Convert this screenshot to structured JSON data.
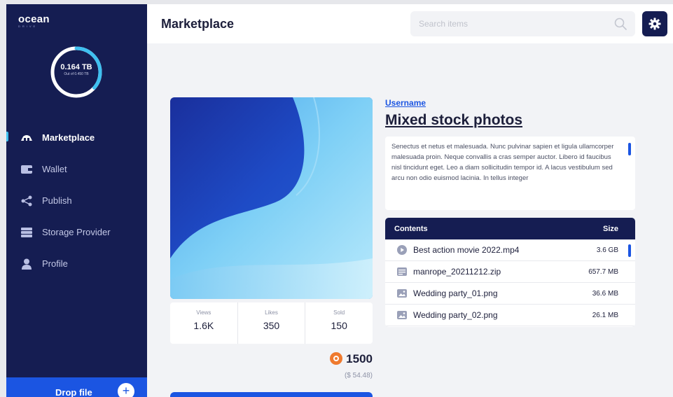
{
  "brand": {
    "name": "ocean",
    "tagline": "DRIVE"
  },
  "storage": {
    "used": "0.164 TB",
    "total_label": "Out of 0.450 TB",
    "fraction_used": 0.364
  },
  "nav": [
    {
      "label": "Marketplace",
      "icon": "marketplace-icon",
      "active": true
    },
    {
      "label": "Wallet",
      "icon": "wallet-icon",
      "active": false
    },
    {
      "label": "Publish",
      "icon": "share-icon",
      "active": false
    },
    {
      "label": "Storage Provider",
      "icon": "storage-icon",
      "active": false
    },
    {
      "label": "Profile",
      "icon": "user-icon",
      "active": false
    }
  ],
  "drop": {
    "label": "Drop file"
  },
  "header": {
    "title": "Marketplace",
    "search_placeholder": "Search items"
  },
  "item": {
    "username": "Username",
    "title": "Mixed stock photos",
    "description": "Senectus et netus et malesuada.  Nunc pulvinar sapien et ligula ullamcorper malesuada proin. Neque  convallis a cras semper auctor. Libero id faucibus nisl tincidunt eget. Leo a diam sollicitudin tempor id. A  lacus vestibulum sed arcu non odio  euismod lacinia. In tellus integer",
    "stats": [
      {
        "label": "Views",
        "value": "1.6K"
      },
      {
        "label": "Likes",
        "value": "350"
      },
      {
        "label": "Sold",
        "value": "150"
      }
    ],
    "price": "1500",
    "price_usd": "($ 54.48)"
  },
  "contents": {
    "header_name": "Contents",
    "header_size": "Size",
    "files": [
      {
        "name": "Best action movie 2022.mp4",
        "size": "3.6 GB",
        "icon": "play-icon"
      },
      {
        "name": "manrope_20211212.zip",
        "size": "657.7 MB",
        "icon": "archive-icon"
      },
      {
        "name": "Wedding party_01.png",
        "size": "36.6 MB",
        "icon": "image-icon"
      },
      {
        "name": "Wedding party_02.png",
        "size": "26.1 MB",
        "icon": "image-icon"
      }
    ]
  },
  "colors": {
    "sidebar": "#151d52",
    "accent": "#1b55e2",
    "ring": "#3fc0f0",
    "coin": "#ef7a2e"
  }
}
